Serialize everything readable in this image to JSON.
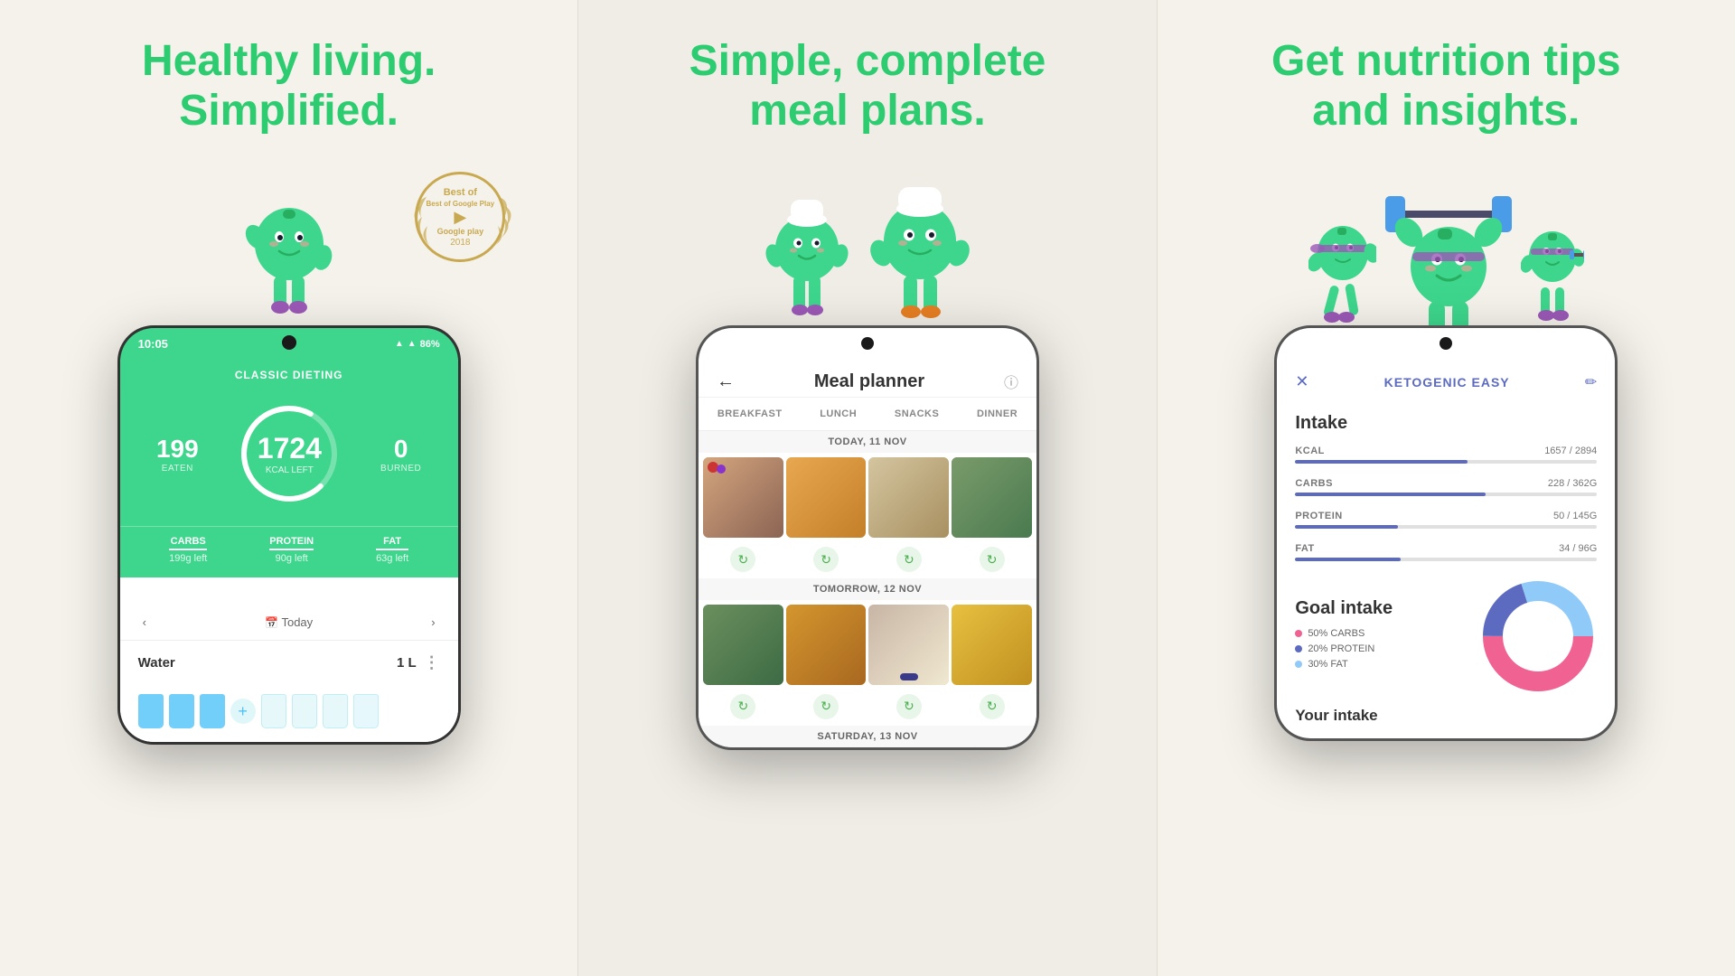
{
  "panel1": {
    "title_line1": "Healthy living.",
    "title_line2": "Simplified.",
    "badge": {
      "line1": "Best of Google Play",
      "line2": "Google play",
      "year": "2018"
    },
    "phone": {
      "status_time": "10:05",
      "status_battery": "86%",
      "diet_type": "CLASSIC DIETING",
      "eaten": "199",
      "eaten_label": "EATEN",
      "kcal_left": "1724",
      "kcal_left_label": "KCAL LEFT",
      "burned": "0",
      "burned_label": "BURNED",
      "carbs_label": "CARBS",
      "carbs_amount": "199g left",
      "protein_label": "PROTEIN",
      "protein_amount": "90g left",
      "fat_label": "FAT",
      "fat_amount": "63g left",
      "nav_today": "Today",
      "water_label": "Water",
      "water_amount": "1 L"
    }
  },
  "panel2": {
    "title": "Simple, complete meal plans.",
    "phone": {
      "header_title": "Meal planner",
      "tabs": [
        "BREAKFAST",
        "LUNCH",
        "SNACKS",
        "DINNER"
      ],
      "day1_label": "TODAY, 11 NOV",
      "day2_label": "TOMORROW, 12 NOV",
      "day3_label": "SATURDAY, 13 NOV"
    }
  },
  "panel3": {
    "title_line1": "Get nutrition tips",
    "title_line2": "and insights.",
    "phone": {
      "plan_name": "KETOGENIC EASY",
      "intake_title": "Intake",
      "kcal_label": "KCAL",
      "kcal_value": "1657 / 2894",
      "kcal_pct": 57,
      "carbs_label": "CARBS",
      "carbs_value": "228 / 362G",
      "carbs_pct": 63,
      "protein_label": "PROTEIN",
      "protein_value": "50 / 145G",
      "protein_pct": 34,
      "fat_label": "FAT",
      "fat_value": "34 / 96G",
      "fat_pct": 35,
      "goal_title": "Goal intake",
      "legend": [
        {
          "label": "50% CARBS",
          "color": "#f06292"
        },
        {
          "label": "20% PROTEIN",
          "color": "#5c6bc0"
        },
        {
          "label": "30% FAT",
          "color": "#90caf9"
        }
      ],
      "donut": {
        "carbs_pct": 50,
        "protein_pct": 20,
        "fat_pct": 30
      },
      "your_intake": "Your intake"
    }
  },
  "icons": {
    "back_arrow": "←",
    "info": "ⓘ",
    "close": "✕",
    "edit": "✏",
    "dots": "⋮",
    "calendar": "📅",
    "prev": "‹",
    "next": "›",
    "refresh": "↻",
    "wifi": "▲",
    "signal": "▲",
    "battery": "▓"
  },
  "colors": {
    "green_accent": "#2ecc71",
    "green_dark": "#27ae60",
    "screen_green": "#3dd68c",
    "indigo": "#5c6bc0",
    "pink": "#f06292",
    "light_blue": "#90caf9"
  }
}
